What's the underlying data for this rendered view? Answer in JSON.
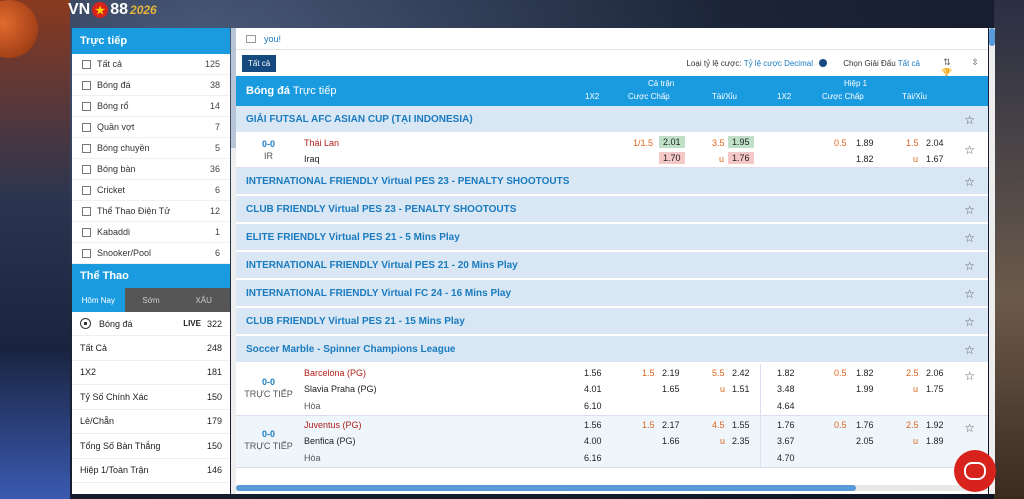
{
  "logo": {
    "brand": "VN",
    "brand2": "88",
    "year": "2026"
  },
  "live_panel": {
    "title": "Trực tiếp",
    "items": [
      {
        "label": "Tất cả",
        "count": "125"
      },
      {
        "label": "Bóng đá",
        "count": "38"
      },
      {
        "label": "Bóng rổ",
        "count": "14"
      },
      {
        "label": "Quần vợt",
        "count": "7"
      },
      {
        "label": "Bóng chuyền",
        "count": "5"
      },
      {
        "label": "Bóng bàn",
        "count": "36"
      },
      {
        "label": "Cricket",
        "count": "6"
      },
      {
        "label": "Thể Thao Điện Tử",
        "count": "12"
      },
      {
        "label": "Kabaddi",
        "count": "1"
      },
      {
        "label": "Snooker/Pool",
        "count": "6"
      }
    ]
  },
  "sports_panel": {
    "title": "Thể Thao",
    "tabs": [
      "Hôm Nay",
      "Sớm",
      "XÂU"
    ],
    "sport": {
      "label": "Bóng đá",
      "live": "LIVE",
      "count": "322"
    },
    "markets": [
      {
        "label": "Tất Cả",
        "count": "248"
      },
      {
        "label": "1X2",
        "count": "181"
      },
      {
        "label": "Tỷ Số Chính Xác",
        "count": "150"
      },
      {
        "label": "Lẻ/Chẵn",
        "count": "179"
      },
      {
        "label": "Tổng Số Bàn Thắng",
        "count": "150"
      },
      {
        "label": "Hiệp 1/Toàn Trận",
        "count": "146"
      }
    ]
  },
  "notice": {
    "text": "you!"
  },
  "toolbar": {
    "all_label": "Tất cả",
    "odds_type_label": "Loại tỷ lệ cược:",
    "odds_type_value": "Tỷ lệ cược Decimal",
    "league_label": "Chọn Giải Đấu",
    "league_value": "Tất cả"
  },
  "header": {
    "sport": "Bóng đá",
    "mode": "Trực tiếp",
    "full": "Cả trận",
    "half": "Hiệp 1",
    "c1x2": "1X2",
    "handicap": "Cược Chấp",
    "ou": "Tài/Xỉu",
    "c1x2_h": "1X2",
    "handicap_h": "Cược Chấp",
    "ou_h": "Tài/Xỉu"
  },
  "leagues": {
    "futsal": "GIẢI FUTSAL AFC ASIAN CUP (TẠI INDONESIA)",
    "l1": "INTERNATIONAL FRIENDLY Virtual PES 23 - PENALTY SHOOTOUTS",
    "l2": "CLUB FRIENDLY Virtual PES 23 - PENALTY SHOOTOUTS",
    "l3": "ELITE FRIENDLY Virtual PES 21 - 5 Mins Play",
    "l4": "INTERNATIONAL FRIENDLY Virtual PES 21 - 20 Mins Play",
    "l5": "INTERNATIONAL FRIENDLY Virtual FC 24 - 16 Mins Play",
    "l6": "CLUB FRIENDLY Virtual PES 21 - 15 Mins Play",
    "marble": "Soccer Marble - Spinner Champions League"
  },
  "match1": {
    "score": "0-0",
    "status": "IR",
    "home": "Thái Lan",
    "away": "Iraq",
    "hc_line": "1/1.5",
    "hc_home": "2.01",
    "hc_away": "1.70",
    "ou_line": "3.5",
    "ou_over": "1.95",
    "ou_u": "u",
    "ou_under": "1.76",
    "h_hc_line": "0.5",
    "h_hc_home": "1.89",
    "h_hc_away": "1.82",
    "h_ou_line": "1.5",
    "h_ou_over": "2.04",
    "h_ou_u": "u",
    "h_ou_under": "1.67"
  },
  "match2": {
    "score": "0-0",
    "status": "TRỰC TIẾP",
    "home": "Barcelona (PG)",
    "away": "Slavia Praha (PG)",
    "draw": "Hòa",
    "x_home": "1.56",
    "x_away": "4.01",
    "x_draw": "6.10",
    "hc_line": "1.5",
    "hc_home": "2.19",
    "hc_away": "1.65",
    "ou_line": "5.5",
    "ou_over": "2.42",
    "ou_u": "u",
    "ou_under": "1.51",
    "hx_home": "1.82",
    "hx_away": "3.48",
    "hx_draw": "4.64",
    "h_hc_line": "0.5",
    "h_hc_home": "1.82",
    "h_hc_away": "1.99",
    "h_ou_line": "2.5",
    "h_ou_over": "2.06",
    "h_ou_u": "u",
    "h_ou_under": "1.75"
  },
  "match3": {
    "score": "0-0",
    "status": "TRỰC TIẾP",
    "home": "Juventus (PG)",
    "away": "Benfica (PG)",
    "draw": "Hòa",
    "x_home": "1.56",
    "x_away": "4.00",
    "x_draw": "6.16",
    "hc_line": "1.5",
    "hc_home": "2.17",
    "hc_away": "1.66",
    "ou_line": "4.5",
    "ou_over": "1.55",
    "ou_u": "u",
    "ou_under": "2.35",
    "hx_home": "1.76",
    "hx_away": "3.67",
    "hx_draw": "4.70",
    "h_hc_line": "0.5",
    "h_hc_home": "1.76",
    "h_hc_away": "2.05",
    "h_ou_line": "2.5",
    "h_ou_over": "1.92",
    "h_ou_u": "u",
    "h_ou_under": "1.89"
  }
}
